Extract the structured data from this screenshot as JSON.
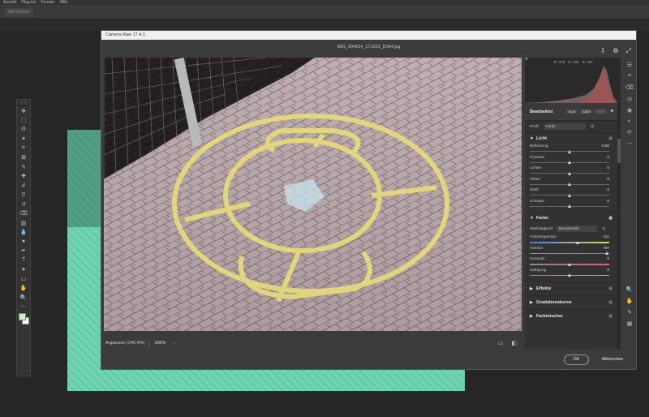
{
  "ps": {
    "menu": [
      "Ansicht",
      "Plug-ins",
      "Fenster",
      "Hilfe"
    ],
    "options_button": "Alle löschen",
    "tools": [
      "move-icon",
      "marquee-icon",
      "lasso-icon",
      "magic-wand-icon",
      "crop-icon",
      "frame-icon",
      "eyedropper-icon",
      "spot-heal-icon",
      "brush-icon",
      "stamp-icon",
      "history-brush-icon",
      "eraser-icon",
      "gradient-icon",
      "blur-icon",
      "dodge-icon",
      "pen-icon",
      "type-icon",
      "path-select-icon",
      "rectangle-icon",
      "hand-icon",
      "zoom-icon",
      "more-icon"
    ],
    "tool_glyphs": [
      "✥",
      "⬚",
      "ʘ",
      "✦",
      "⌗",
      "⊠",
      "✎",
      "✚",
      "✐",
      "⚲",
      "↺",
      "⌫",
      "▥",
      "💧",
      "●",
      "✒",
      "T",
      "➤",
      "▭",
      "✋",
      "🔍",
      "⋯"
    ],
    "fg_color": "#c9f2c9",
    "bg_color": "#ffffff"
  },
  "cr": {
    "title": "Camera Raw 17.4.1",
    "filename": "IMG_004534_171223_B164.jpg",
    "zoom_fit": "Anpassen (245,4%)",
    "zoom_100": "100%",
    "ok": "OK",
    "cancel": "Abbrechen",
    "histogram": {
      "r": "R: 203",
      "g": "G: 206",
      "b": "B: 207"
    },
    "panel": {
      "tab": "Bearbeiten",
      "auto": "Auto",
      "bw": "S&W",
      "hdr": "HDR",
      "profile_label": "Profil",
      "profile_value": "Farbe",
      "licht": "Licht",
      "farbe": "Farbe",
      "effekte": "Effekte",
      "gradation": "Gradationskurve",
      "farbmischer": "Farbmischer",
      "wb_label": "Weißabgleich",
      "wb_value": "Benutzerdef.",
      "sliders_licht": [
        {
          "label": "Belichtung",
          "value": "0,00",
          "pos": 0.5
        },
        {
          "label": "Kontrast",
          "value": "0",
          "pos": 0.5
        },
        {
          "label": "Lichter",
          "value": "0",
          "pos": 0.5
        },
        {
          "label": "Tiefen",
          "value": "0",
          "pos": 0.5
        },
        {
          "label": "Weiß",
          "value": "0",
          "pos": 0.5
        },
        {
          "label": "Schwarz",
          "value": "0",
          "pos": 0.5
        }
      ],
      "sliders_farbe": [
        {
          "label": "Farbtemperatur",
          "value": "+21",
          "pos": 0.6
        },
        {
          "label": "Farbton",
          "value": "+97",
          "pos": 0.97
        },
        {
          "label": "Dynamik",
          "value": "0",
          "pos": 0.5
        },
        {
          "label": "Sättigung",
          "value": "0",
          "pos": 0.5
        }
      ]
    }
  }
}
